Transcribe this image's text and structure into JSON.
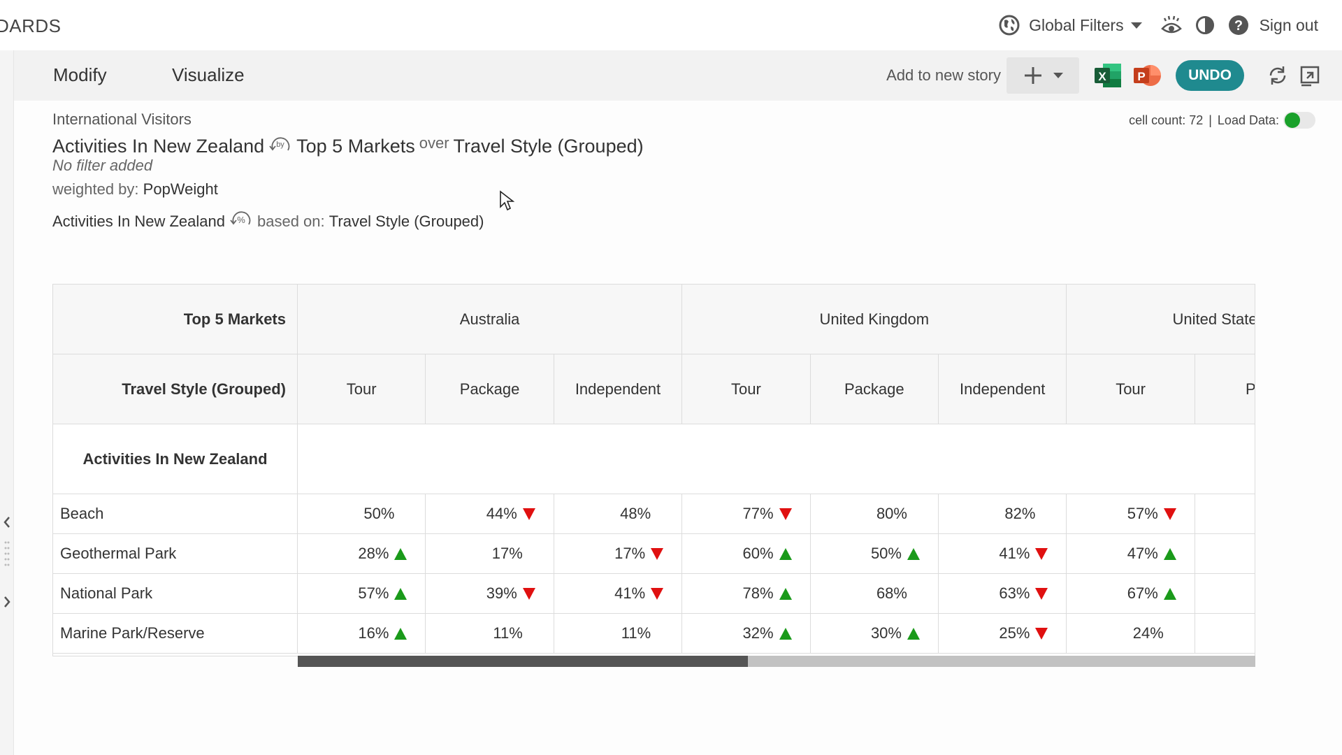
{
  "header": {
    "brand": "DARDS",
    "global_filters": "Global Filters",
    "sign_out": "Sign out"
  },
  "toolbar": {
    "tab_modify": "Modify",
    "tab_visualize": "Visualize",
    "add_to_story": "Add to new story",
    "excel_letter": "X",
    "ppt_letter": "P",
    "undo": "UNDO"
  },
  "meta": {
    "dataset": "International Visitors",
    "row_var": "Activities In New Zealand",
    "by_badge": "by",
    "col_var_1": "Top 5 Markets",
    "over": "over",
    "col_var_2": "Travel Style (Grouped)",
    "filter": "No filter added",
    "weighted_prefix": "weighted by:",
    "weight": "PopWeight",
    "pct_var": "Activities In New Zealand",
    "pct_badge": "%",
    "based_prefix": "based on:",
    "based_on": "Travel Style (Grouped)",
    "cell_count": "cell count: 72",
    "separator": "|",
    "load_data": "Load Data:"
  },
  "table": {
    "header_row1_label": "Top 5 Markets",
    "header_row2_label": "Travel Style (Grouped)",
    "section_label": "Activities In New Zealand",
    "markets": [
      "Australia",
      "United Kingdom",
      "United States Of America"
    ],
    "styles": [
      "Tour",
      "Package",
      "Independent",
      "Tour",
      "Package",
      "Independent",
      "Tour",
      "Pac"
    ],
    "rows": [
      {
        "label": "Beach",
        "cells": [
          {
            "value": "50%",
            "trend": ""
          },
          {
            "value": "44%",
            "trend": "down"
          },
          {
            "value": "48%",
            "trend": ""
          },
          {
            "value": "77%",
            "trend": "down"
          },
          {
            "value": "80%",
            "trend": ""
          },
          {
            "value": "82%",
            "trend": ""
          },
          {
            "value": "57%",
            "trend": "down"
          }
        ]
      },
      {
        "label": "Geothermal Park",
        "cells": [
          {
            "value": "28%",
            "trend": "up"
          },
          {
            "value": "17%",
            "trend": ""
          },
          {
            "value": "17%",
            "trend": "down"
          },
          {
            "value": "60%",
            "trend": "up"
          },
          {
            "value": "50%",
            "trend": "up"
          },
          {
            "value": "41%",
            "trend": "down"
          },
          {
            "value": "47%",
            "trend": "up"
          }
        ]
      },
      {
        "label": "National Park",
        "cells": [
          {
            "value": "57%",
            "trend": "up"
          },
          {
            "value": "39%",
            "trend": "down"
          },
          {
            "value": "41%",
            "trend": "down"
          },
          {
            "value": "78%",
            "trend": "up"
          },
          {
            "value": "68%",
            "trend": ""
          },
          {
            "value": "63%",
            "trend": "down"
          },
          {
            "value": "67%",
            "trend": "up"
          }
        ]
      },
      {
        "label": "Marine Park/Reserve",
        "cells": [
          {
            "value": "16%",
            "trend": "up"
          },
          {
            "value": "11%",
            "trend": ""
          },
          {
            "value": "11%",
            "trend": ""
          },
          {
            "value": "32%",
            "trend": "up"
          },
          {
            "value": "30%",
            "trend": "up"
          },
          {
            "value": "25%",
            "trend": "down"
          },
          {
            "value": "24%",
            "trend": ""
          }
        ]
      }
    ]
  },
  "colors": {
    "undo_bg": "#1f8a8f",
    "trend_up": "#1a9a1a",
    "trend_down": "#e01010",
    "toggle_on": "#1aa12b",
    "excel": "#1e7145",
    "powerpoint": "#d24726"
  },
  "icons": [
    "globe-icon",
    "eye-icon",
    "contrast-icon",
    "help-icon",
    "plus-icon",
    "excel-icon",
    "powerpoint-icon",
    "refresh-icon",
    "expand-icon",
    "chevron-left-icon",
    "chevron-right-icon"
  ],
  "scroll": {
    "thumb_fraction": 0.47
  }
}
